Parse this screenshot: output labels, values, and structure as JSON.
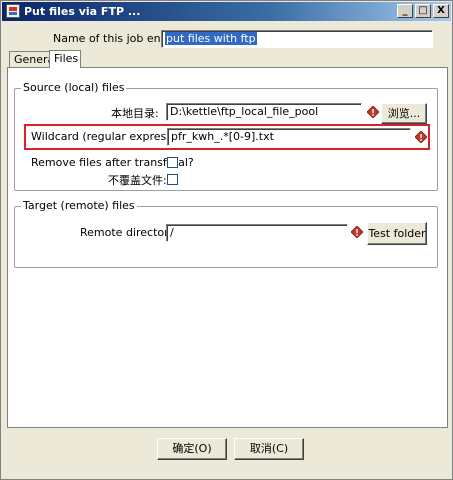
{
  "window": {
    "title": "Put files via FTP ...",
    "controls": {
      "minimize": "_",
      "maximize": "□",
      "close": "X"
    }
  },
  "header": {
    "job_entry_label": "Name of this job entry:",
    "job_entry_value": "put files with ftp"
  },
  "tabs": [
    {
      "label": "General",
      "active": false
    },
    {
      "label": "Files",
      "active": true
    }
  ],
  "source_group": {
    "title": "Source (local) files",
    "local_dir_label": "本地目录:",
    "local_dir_value": "D:\\kettle\\ftp_local_file_pool",
    "browse_label": "浏览...",
    "wildcard_label": "Wildcard (regular expression):",
    "wildcard_value": "pfr_kwh_.*[0-9].txt",
    "remove_label": "Remove files after transferal?",
    "remove_checked": false,
    "no_overwrite_label": "不覆盖文件:",
    "no_overwrite_checked": false
  },
  "target_group": {
    "title": "Target (remote) files",
    "remote_dir_label": "Remote directory:",
    "remote_dir_value": "/",
    "test_folder_label": "Test folder"
  },
  "footer": {
    "ok_label": "确定(O)",
    "cancel_label": "取消(C)"
  },
  "colors": {
    "highlight": "#d8232a",
    "titlebar": "#0a246a",
    "selection": "#316ac5"
  },
  "icons": {
    "variable": "variable-diamond-icon",
    "app": "kettle-app-icon"
  }
}
